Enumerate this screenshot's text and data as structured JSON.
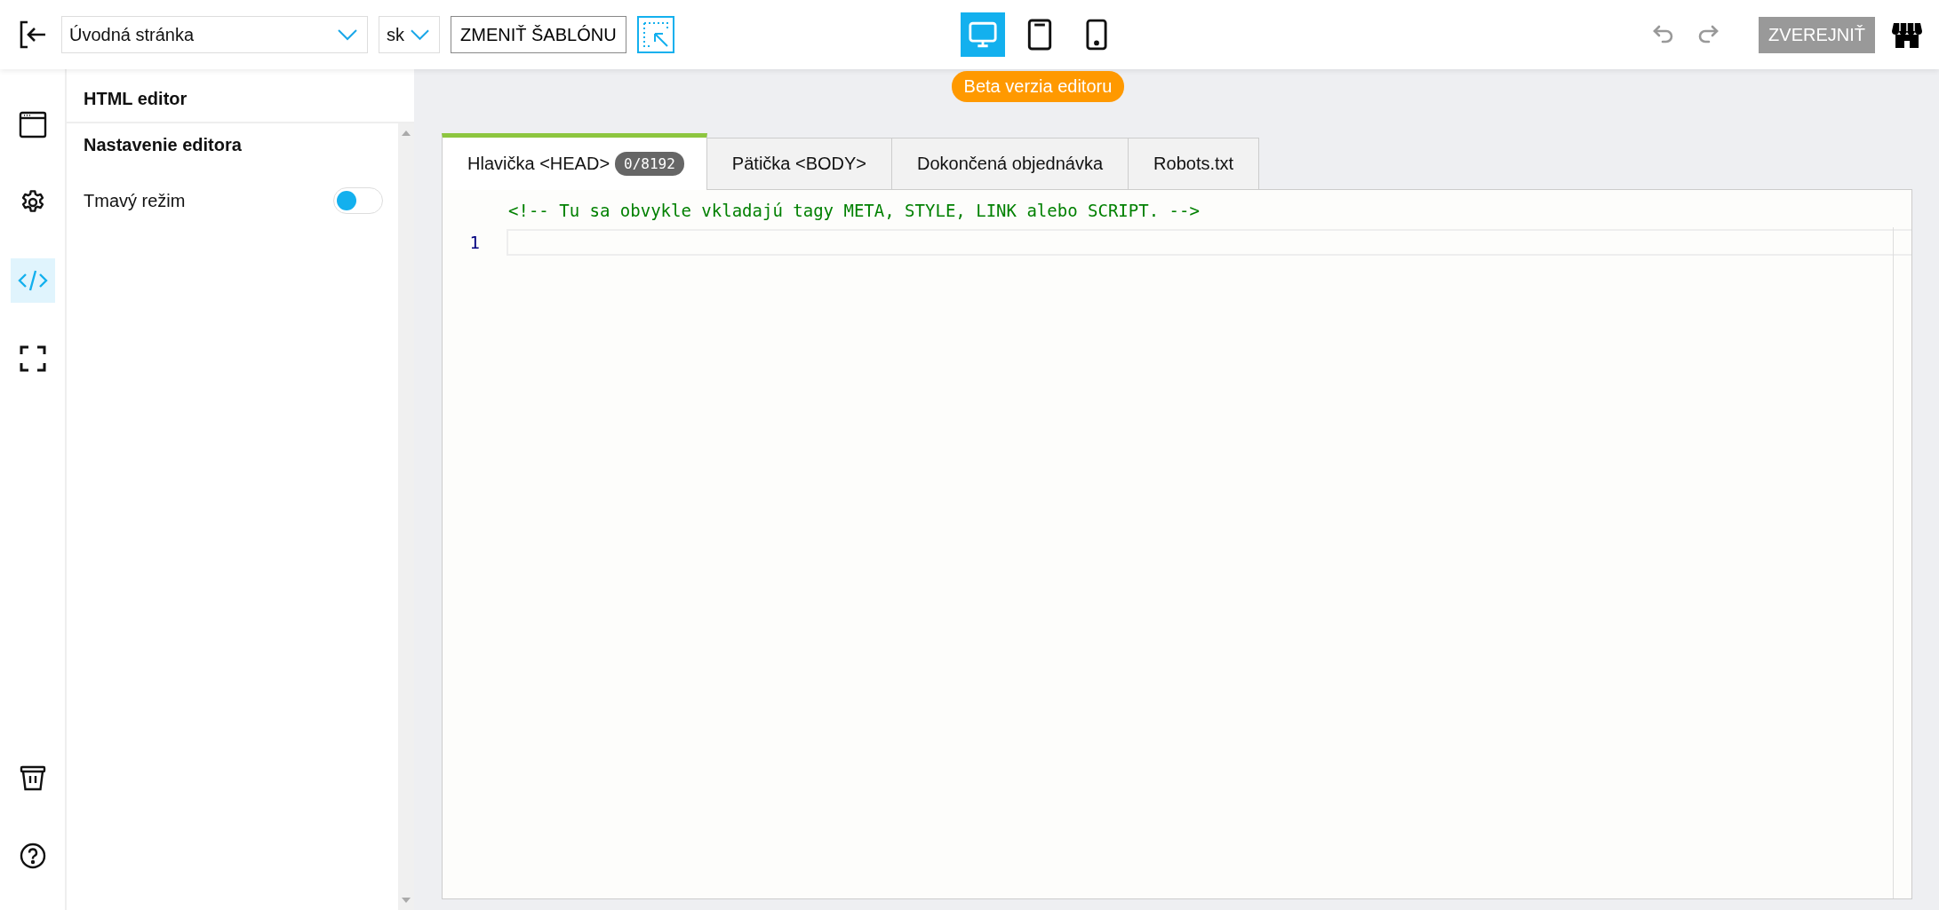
{
  "topbar": {
    "page_select": {
      "value": "Úvodná stránka"
    },
    "language_select": {
      "value": "sk"
    },
    "change_template_button": "ZMENIŤ ŠABLÓNU",
    "devices": [
      {
        "kind": "desktop",
        "selected": true
      },
      {
        "kind": "tablet",
        "selected": false
      },
      {
        "kind": "phone",
        "selected": false
      }
    ],
    "beta_badge": "Beta verzia editoru",
    "history_buttons": [
      {
        "kind": "undo",
        "disabled": true
      },
      {
        "kind": "redo",
        "disabled": true
      }
    ],
    "publish_button": {
      "label": "ZVEREJNIŤ",
      "disabled": true
    }
  },
  "rail": {
    "items": [
      {
        "kind": "layout",
        "selected": false
      },
      {
        "kind": "settings",
        "selected": false
      },
      {
        "kind": "code",
        "selected": true
      },
      {
        "kind": "fullscreen",
        "selected": false
      }
    ],
    "bottom_items": [
      {
        "kind": "trash"
      },
      {
        "kind": "help"
      }
    ]
  },
  "panel": {
    "title": "HTML editor",
    "section": "Nastavenie editora",
    "settings": [
      {
        "label": "Tmavý režim",
        "on": false
      }
    ]
  },
  "editor": {
    "tabs": [
      {
        "label": "Hlavička <HEAD>",
        "badge": "0/8192",
        "selected": true
      },
      {
        "label": "Pätička <BODY>",
        "selected": false
      },
      {
        "label": "Dokončená objednávka",
        "selected": false
      },
      {
        "label": "Robots.txt",
        "selected": false
      }
    ],
    "comment": "<!-- Tu sa obvykle vkladajú tagy META, STYLE, LINK alebo SCRIPT. -->",
    "line_numbers": [
      "1"
    ]
  }
}
